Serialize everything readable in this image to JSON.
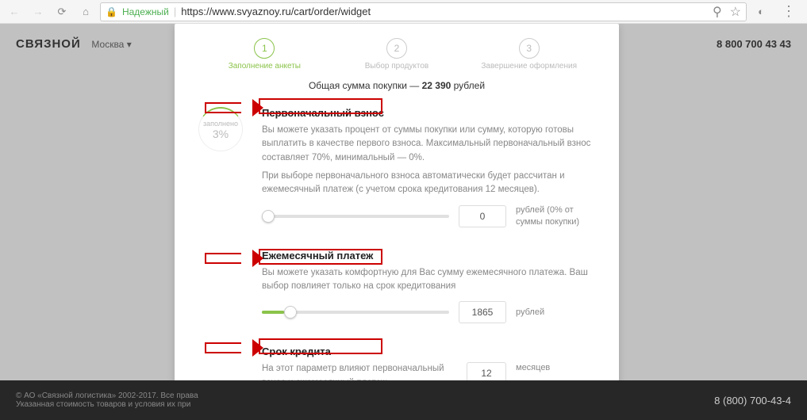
{
  "browser": {
    "secure_label": "Надежный",
    "url": "https://www.svyaznoy.ru/cart/order/widget"
  },
  "header": {
    "logo": "СВЯЗНОЙ",
    "city": "Москва",
    "phone": "8 800 700 43 43"
  },
  "steps": [
    {
      "num": "1",
      "label": "Заполнение анкеты"
    },
    {
      "num": "2",
      "label": "Выбор продуктов"
    },
    {
      "num": "3",
      "label": "Завершение оформления"
    }
  ],
  "total": {
    "prefix": "Общая сумма покупки — ",
    "amount": "22 390",
    "suffix": " рублей"
  },
  "badge": {
    "label": "заполнено",
    "pct": "3%"
  },
  "sections": {
    "downpayment": {
      "title": "Первоначальный взнос",
      "desc1": "Вы можете указать процент от суммы покупки или сумму, которую готовы выплатить в качестве первого взноса. Максимальный первоначальный взнос составляет 70%, минимальный — 0%.",
      "desc2": "При выборе первоначального взноса автоматически будет рассчитан и ежемесячный платеж (с учетом срока кредитования 12 месяцев).",
      "value": "0",
      "unit": "рублей (0% от суммы покупки)"
    },
    "monthly": {
      "title": "Ежемесячный платеж",
      "desc": "Вы можете указать комфортную для Вас сумму ежемесячного платежа. Ваш выбор повлияет только на срок кредитования",
      "value": "1865",
      "unit": "рублей"
    },
    "term": {
      "title": "Срок кредита",
      "desc": "На этот параметр влияют первоначальный взнос и ежемесячный платеж",
      "value": "12",
      "unit": "месяцев"
    }
  },
  "footer": {
    "copyright": "© АО «Связной логистика» 2002-2017. Все права",
    "note": "Указанная стоимость товаров и условия их при",
    "phone": "8 (800) 700-43-4"
  }
}
